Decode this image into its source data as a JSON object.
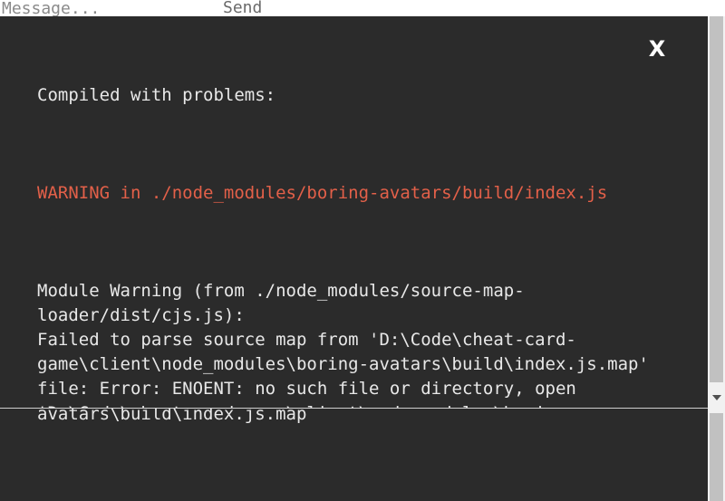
{
  "background": {
    "message_placeholder": "Message...",
    "send_label": "Send"
  },
  "overlay": {
    "title": "Compiled with problems:",
    "close_label": "X",
    "warning": "WARNING in ./node_modules/boring-avatars/build/index.js",
    "message": "Module Warning (from ./node_modules/source-map-loader/dist/cjs.js):\nFailed to parse source map from 'D:\\Code\\cheat-card-game\\client\\node_modules\\boring-avatars\\build\\index.js.map' file: Error: ENOENT: no such file or directory, open 'D:\\Code\\cheat-card-game\\client\\node_modules\\boring-avatars\\build\\index.js.map'"
  },
  "overlay_behind": {
    "visible_text": "avatars\\build\\index.js.map"
  },
  "colors": {
    "overlay_bg": "#2b2b2b",
    "warning_text": "#e36049",
    "body_text": "#e8e8e8"
  }
}
